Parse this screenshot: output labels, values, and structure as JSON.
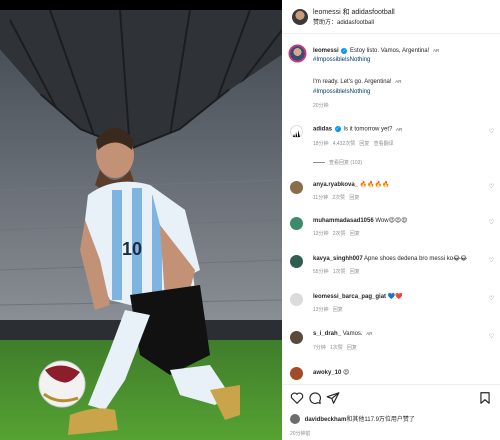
{
  "header": {
    "title": "leomessi 和 adidasfootball",
    "subtitle": "赞助方：adidasfootball"
  },
  "caption": {
    "user": "leomessi",
    "text": "Estoy listo. Vamos, Argentina!",
    "ar": "AR",
    "hashtag": "#ImpossibleIsNothing",
    "translation": "I'm ready. Let's go. Argentina!",
    "translation_ar": "AR",
    "translation_hashtag": "#ImpossibleIsNothing",
    "time": "20分钟"
  },
  "comments": [
    {
      "user": "adidas",
      "text": "Is it tomorrow yet?",
      "ar": "AR",
      "time": "18分钟",
      "likes": "4,432次赞",
      "reply": "回复",
      "translate": "查看翻译",
      "view_replies": "查看回复 (103)",
      "avatar_color": "#000000"
    },
    {
      "user": "anya.ryabkova_",
      "text": "🔥🔥🔥🔥",
      "time": "11分钟",
      "likes": "2次赞",
      "reply": "回复",
      "avatar_color": "#8a6e4b"
    },
    {
      "user": "muhammadasad1056",
      "text": "Wow😍😍😍",
      "time": "13分钟",
      "likes": "2次赞",
      "reply": "回复",
      "avatar_color": "#3d8b6d"
    },
    {
      "user": "kavya_singhh007",
      "text": "Apne shoes dedena bro messi ko😂😂",
      "time": "55分钟",
      "likes": "1次赞",
      "reply": "回复",
      "avatar_color": "#2f5d50"
    },
    {
      "user": "leomessi_barca_pag_giat",
      "text": "💙❤️",
      "time": "13分钟",
      "reply": "回复",
      "avatar_color": "#dbdbdb"
    },
    {
      "user": "s_i_drah_",
      "text": "Vamos.",
      "ar": "AR",
      "time": "7分钟",
      "likes": "1次赞",
      "reply": "回复",
      "avatar_color": "#5a4a3a"
    },
    {
      "user": "awoky_10",
      "text": "😍",
      "avatar_color": "#a34a2a"
    }
  ],
  "actions": {
    "liked_by_user": "davidbeckham",
    "liked_by_rest": "和其他117.9万位用户赞了",
    "time_ago": "20分钟前"
  },
  "icons": {
    "like": "heart-icon",
    "comment": "comment-icon",
    "share": "paper-plane-icon",
    "save": "bookmark-icon"
  }
}
